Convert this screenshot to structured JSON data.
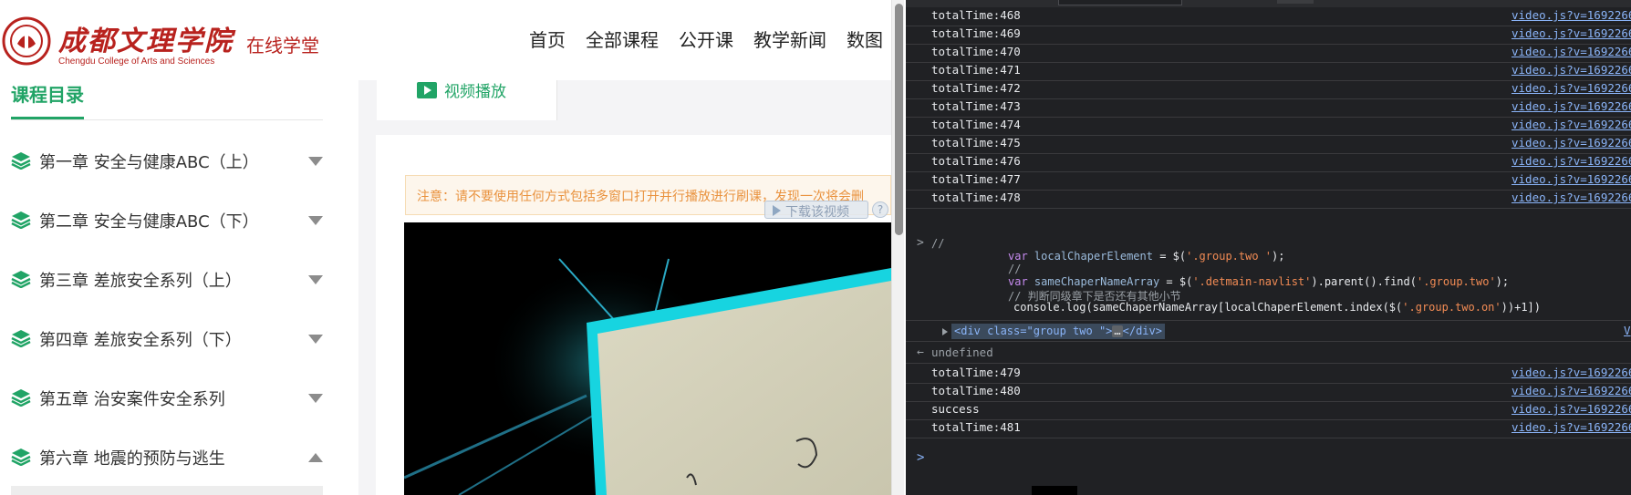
{
  "site": {
    "logo": {
      "cn": "成都文理学院",
      "en": "Chengdu College of Arts and Sciences",
      "sub": "在线学堂"
    },
    "nav": [
      "首页",
      "全部课程",
      "公开课",
      "教学新闻",
      "数图"
    ],
    "catalog_title": "课程目录",
    "tab_label": "视频播放",
    "chapters": [
      {
        "label": "第一章 安全与健康ABC（上）",
        "expanded": false
      },
      {
        "label": "第二章 安全与健康ABC（下）",
        "expanded": false
      },
      {
        "label": "第三章 差旅安全系列（上）",
        "expanded": false
      },
      {
        "label": "第四章 差旅安全系列（下）",
        "expanded": false
      },
      {
        "label": "第五章 治安案件安全系列",
        "expanded": false
      },
      {
        "label": "第六章 地震的预防与逃生",
        "expanded": true
      }
    ],
    "notice": "注意：请不要使用任何方式包括多窗口打开并行播放进行刷课，发现一次将会删",
    "download_overlay": {
      "label": "下载该视频",
      "help": "?",
      "close": "x"
    },
    "colors": {
      "brand_red": "#b8221e",
      "accent_green": "#21a466",
      "notice_orange": "#e9923e"
    }
  },
  "console": {
    "rows_before": [
      {
        "text": "totalTime:468",
        "source": "video.js?v=1692266"
      },
      {
        "text": "totalTime:469",
        "source": "video.js?v=1692266"
      },
      {
        "text": "totalTime:470",
        "source": "video.js?v=1692266"
      },
      {
        "text": "totalTime:471",
        "source": "video.js?v=1692266"
      },
      {
        "text": "totalTime:472",
        "source": "video.js?v=1692266"
      },
      {
        "text": "totalTime:473",
        "source": "video.js?v=1692266"
      },
      {
        "text": "totalTime:474",
        "source": "video.js?v=1692266"
      },
      {
        "text": "totalTime:475",
        "source": "video.js?v=1692266"
      },
      {
        "text": "totalTime:476",
        "source": "video.js?v=1692266"
      },
      {
        "text": "totalTime:477",
        "source": "video.js?v=1692266"
      },
      {
        "text": "totalTime:478",
        "source": "video.js?v=1692266"
      }
    ],
    "input": {
      "line1": "//",
      "line2_kw": "var",
      "line2_var": "localChaperElement",
      "line2_mid": " = $(",
      "line2_str": "'.group.two '",
      "line2_end": ");",
      "line3": "//",
      "line4_kw": "var",
      "line4_var": "sameChaperNameArray",
      "line4_mid1": " = $(",
      "line4_str1": "'.detmain-navlist'",
      "line4_mid2": ").parent().find(",
      "line4_str2": "'.group.two'",
      "line4_end": ");",
      "line5": "// 判断同级章下是否还有其他小节",
      "line6_a": "console.log(sameChaperNameArray[localChaperElement.index($(",
      "line6_str": "'.group.two.on'",
      "line6_b": "))+1])"
    },
    "element_output": {
      "open": "<div class=\"group two \">",
      "ellipsis": "…",
      "close": "</div>",
      "source": "V"
    },
    "result": {
      "arrow": "←",
      "text": "undefined"
    },
    "rows_after": [
      {
        "text": "totalTime:479",
        "source": "video.js?v=1692266"
      },
      {
        "text": "totalTime:480",
        "source": "video.js?v=1692266"
      },
      {
        "text": "success",
        "source": "video.js?v=1692266"
      },
      {
        "text": "totalTime:481",
        "source": "video.js?v=1692266"
      }
    ],
    "prompt_chevron": ">",
    "colors": {
      "bg": "#202124",
      "link": "#8ab4f8",
      "keyword": "#c78bf0",
      "string": "#f28b54"
    }
  }
}
